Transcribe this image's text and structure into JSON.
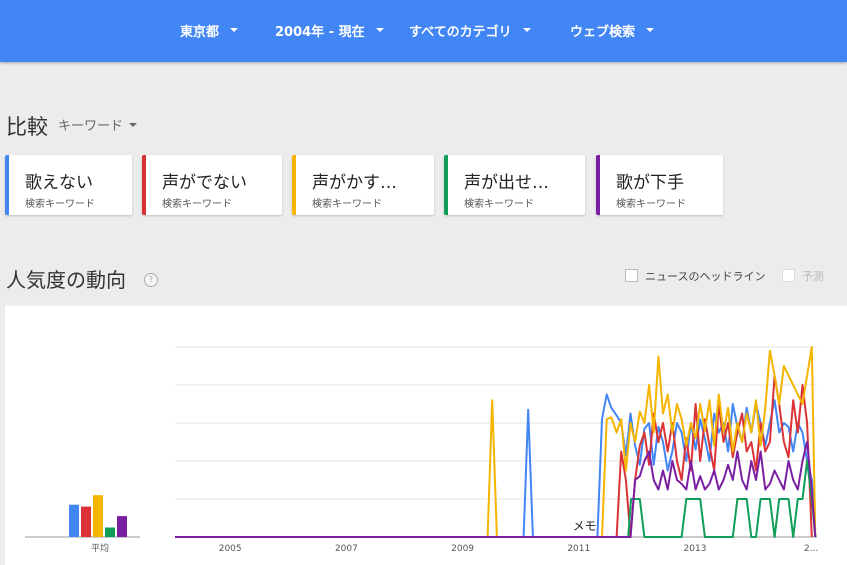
{
  "filters": [
    {
      "label": "東京都"
    },
    {
      "label": "2004年 - 現在"
    },
    {
      "label": "すべてのカテゴリ"
    },
    {
      "label": "ウェブ検索"
    }
  ],
  "compare": {
    "title": "比較",
    "type_label": "キーワード"
  },
  "terms": [
    {
      "label": "歌えない",
      "sub": "検索キーワード",
      "color": "#4285f4"
    },
    {
      "label": "声がでない",
      "sub": "検索キーワード",
      "color": "#db3236"
    },
    {
      "label": "声がかす…",
      "sub": "検索キーワード",
      "color": "#f4b400"
    },
    {
      "label": "声が出せ…",
      "sub": "検索キーワード",
      "color": "#0f9d58"
    },
    {
      "label": "歌が下手",
      "sub": "検索キーワード",
      "color": "#7b1fa2"
    }
  ],
  "interest": {
    "title": "人気度の動向",
    "help_icon": "?",
    "news_label": "ニュースのヘッドライン",
    "forecast_label": "予測"
  },
  "chart_data": {
    "type": "line",
    "averages_label": "平均",
    "averages": [
      {
        "name": "歌えない",
        "value": 17
      },
      {
        "name": "声がでない",
        "value": 16
      },
      {
        "name": "声がかす…",
        "value": 22
      },
      {
        "name": "声が出せ…",
        "value": 5
      },
      {
        "name": "歌が下手",
        "value": 11
      }
    ],
    "x_ticks": [
      "2005",
      "2007",
      "2009",
      "2011",
      "2013",
      "2..."
    ],
    "annotation": "メモ",
    "ylim": [
      0,
      100
    ],
    "grid": true,
    "series": [
      {
        "name": "歌えない",
        "color": "#4285f4",
        "points": [
          [
            2004.0,
            0
          ],
          [
            2010.0,
            0
          ],
          [
            2010.08,
            67
          ],
          [
            2010.16,
            0
          ],
          [
            2011.27,
            0
          ],
          [
            2011.35,
            62
          ],
          [
            2011.43,
            75
          ],
          [
            2011.51,
            68
          ],
          [
            2011.6,
            64
          ],
          [
            2011.68,
            60
          ],
          [
            2011.76,
            43
          ],
          [
            2011.84,
            65
          ],
          [
            2011.92,
            48
          ],
          [
            2012.0,
            38
          ],
          [
            2012.08,
            57
          ],
          [
            2012.16,
            60
          ],
          [
            2012.24,
            38
          ],
          [
            2012.32,
            58
          ],
          [
            2012.4,
            50
          ],
          [
            2012.48,
            35
          ],
          [
            2012.56,
            45
          ],
          [
            2012.64,
            60
          ],
          [
            2012.72,
            55
          ],
          [
            2012.8,
            40
          ],
          [
            2012.88,
            60
          ],
          [
            2012.96,
            46
          ],
          [
            2013.04,
            62
          ],
          [
            2013.12,
            52
          ],
          [
            2013.2,
            40
          ],
          [
            2013.28,
            65
          ],
          [
            2013.36,
            55
          ],
          [
            2013.44,
            60
          ],
          [
            2013.52,
            45
          ],
          [
            2013.6,
            70
          ],
          [
            2013.68,
            58
          ],
          [
            2013.76,
            50
          ],
          [
            2013.84,
            68
          ],
          [
            2013.92,
            55
          ],
          [
            2014.0,
            70
          ],
          [
            2014.08,
            60
          ],
          [
            2014.16,
            48
          ],
          [
            2014.24,
            60
          ],
          [
            2014.32,
            72
          ],
          [
            2014.4,
            55
          ],
          [
            2014.48,
            60
          ],
          [
            2014.56,
            58
          ],
          [
            2014.64,
            45
          ],
          [
            2014.72,
            60
          ],
          [
            2014.8,
            55
          ],
          [
            2014.88,
            40
          ],
          [
            2014.96,
            30
          ],
          [
            2015.02,
            0
          ]
        ]
      },
      {
        "name": "声がでない",
        "color": "#db3236",
        "points": [
          [
            2004.0,
            0
          ],
          [
            2011.6,
            0
          ],
          [
            2011.68,
            45
          ],
          [
            2011.76,
            30
          ],
          [
            2011.84,
            0
          ],
          [
            2011.92,
            30
          ],
          [
            2012.0,
            48
          ],
          [
            2012.08,
            55
          ],
          [
            2012.16,
            38
          ],
          [
            2012.24,
            65
          ],
          [
            2012.32,
            50
          ],
          [
            2012.4,
            60
          ],
          [
            2012.48,
            45
          ],
          [
            2012.56,
            60
          ],
          [
            2012.64,
            40
          ],
          [
            2012.72,
            30
          ],
          [
            2012.8,
            52
          ],
          [
            2012.88,
            35
          ],
          [
            2012.96,
            70
          ],
          [
            2013.04,
            40
          ],
          [
            2013.12,
            62
          ],
          [
            2013.2,
            48
          ],
          [
            2013.28,
            35
          ],
          [
            2013.36,
            70
          ],
          [
            2013.44,
            50
          ],
          [
            2013.52,
            60
          ],
          [
            2013.6,
            42
          ],
          [
            2013.68,
            55
          ],
          [
            2013.76,
            65
          ],
          [
            2013.84,
            45
          ],
          [
            2013.92,
            50
          ],
          [
            2014.0,
            35
          ],
          [
            2014.08,
            60
          ],
          [
            2014.16,
            45
          ],
          [
            2014.24,
            50
          ],
          [
            2014.32,
            85
          ],
          [
            2014.4,
            70
          ],
          [
            2014.48,
            50
          ],
          [
            2014.56,
            42
          ],
          [
            2014.64,
            72
          ],
          [
            2014.72,
            55
          ],
          [
            2014.8,
            80
          ],
          [
            2014.88,
            60
          ],
          [
            2014.96,
            0
          ]
        ]
      },
      {
        "name": "声がかす…",
        "color": "#f4b400",
        "points": [
          [
            2004.0,
            0
          ],
          [
            2009.38,
            0
          ],
          [
            2009.46,
            72
          ],
          [
            2009.54,
            0
          ],
          [
            2011.35,
            0
          ],
          [
            2011.43,
            62
          ],
          [
            2011.51,
            63
          ],
          [
            2011.6,
            55
          ],
          [
            2011.68,
            62
          ],
          [
            2011.76,
            35
          ],
          [
            2011.84,
            60
          ],
          [
            2011.92,
            50
          ],
          [
            2012.0,
            66
          ],
          [
            2012.08,
            60
          ],
          [
            2012.16,
            80
          ],
          [
            2012.24,
            55
          ],
          [
            2012.32,
            95
          ],
          [
            2012.4,
            65
          ],
          [
            2012.48,
            75
          ],
          [
            2012.56,
            55
          ],
          [
            2012.64,
            70
          ],
          [
            2012.72,
            62
          ],
          [
            2012.8,
            48
          ],
          [
            2012.88,
            60
          ],
          [
            2012.96,
            52
          ],
          [
            2013.04,
            70
          ],
          [
            2013.12,
            56
          ],
          [
            2013.2,
            72
          ],
          [
            2013.28,
            48
          ],
          [
            2013.36,
            75
          ],
          [
            2013.44,
            55
          ],
          [
            2013.52,
            68
          ],
          [
            2013.6,
            45
          ],
          [
            2013.68,
            60
          ],
          [
            2013.76,
            50
          ],
          [
            2013.84,
            65
          ],
          [
            2013.92,
            55
          ],
          [
            2014.0,
            72
          ],
          [
            2014.08,
            48
          ],
          [
            2014.16,
            68
          ],
          [
            2014.24,
            98
          ],
          [
            2014.32,
            85
          ],
          [
            2014.4,
            70
          ],
          [
            2014.48,
            90
          ],
          [
            2014.56,
            85
          ],
          [
            2014.64,
            80
          ],
          [
            2014.72,
            75
          ],
          [
            2014.8,
            70
          ],
          [
            2014.88,
            85
          ],
          [
            2014.96,
            100
          ],
          [
            2015.02,
            0
          ]
        ]
      },
      {
        "name": "声が出せ…",
        "color": "#0f9d58",
        "points": [
          [
            2004.0,
            0
          ],
          [
            2011.8,
            0
          ],
          [
            2011.85,
            20
          ],
          [
            2012.0,
            20
          ],
          [
            2012.08,
            0
          ],
          [
            2012.72,
            0
          ],
          [
            2012.8,
            20
          ],
          [
            2013.04,
            20
          ],
          [
            2013.12,
            0
          ],
          [
            2013.6,
            0
          ],
          [
            2013.68,
            20
          ],
          [
            2013.84,
            20
          ],
          [
            2013.92,
            0
          ],
          [
            2014.0,
            0
          ],
          [
            2014.08,
            20
          ],
          [
            2014.24,
            20
          ],
          [
            2014.32,
            0
          ],
          [
            2014.4,
            20
          ],
          [
            2014.56,
            20
          ],
          [
            2014.64,
            0
          ],
          [
            2014.72,
            20
          ],
          [
            2014.8,
            20
          ],
          [
            2014.88,
            40
          ],
          [
            2014.96,
            20
          ],
          [
            2015.02,
            0
          ]
        ]
      },
      {
        "name": "歌が下手",
        "color": "#7b1fa2",
        "points": [
          [
            2004.0,
            0
          ],
          [
            2011.84,
            0
          ],
          [
            2011.92,
            30
          ],
          [
            2012.0,
            32
          ],
          [
            2012.08,
            40
          ],
          [
            2012.16,
            45
          ],
          [
            2012.24,
            30
          ],
          [
            2012.32,
            25
          ],
          [
            2012.4,
            35
          ],
          [
            2012.48,
            25
          ],
          [
            2012.56,
            40
          ],
          [
            2012.64,
            30
          ],
          [
            2012.72,
            28
          ],
          [
            2012.8,
            25
          ],
          [
            2012.88,
            40
          ],
          [
            2012.96,
            25
          ],
          [
            2013.04,
            32
          ],
          [
            2013.12,
            25
          ],
          [
            2013.2,
            28
          ],
          [
            2013.28,
            35
          ],
          [
            2013.36,
            25
          ],
          [
            2013.44,
            30
          ],
          [
            2013.52,
            38
          ],
          [
            2013.6,
            30
          ],
          [
            2013.68,
            45
          ],
          [
            2013.76,
            30
          ],
          [
            2013.84,
            25
          ],
          [
            2013.92,
            40
          ],
          [
            2014.0,
            30
          ],
          [
            2014.08,
            45
          ],
          [
            2014.16,
            25
          ],
          [
            2014.24,
            28
          ],
          [
            2014.32,
            35
          ],
          [
            2014.4,
            30
          ],
          [
            2014.48,
            25
          ],
          [
            2014.56,
            40
          ],
          [
            2014.64,
            30
          ],
          [
            2014.72,
            25
          ],
          [
            2014.8,
            40
          ],
          [
            2014.88,
            50
          ],
          [
            2014.96,
            25
          ],
          [
            2015.02,
            0
          ]
        ]
      }
    ]
  }
}
